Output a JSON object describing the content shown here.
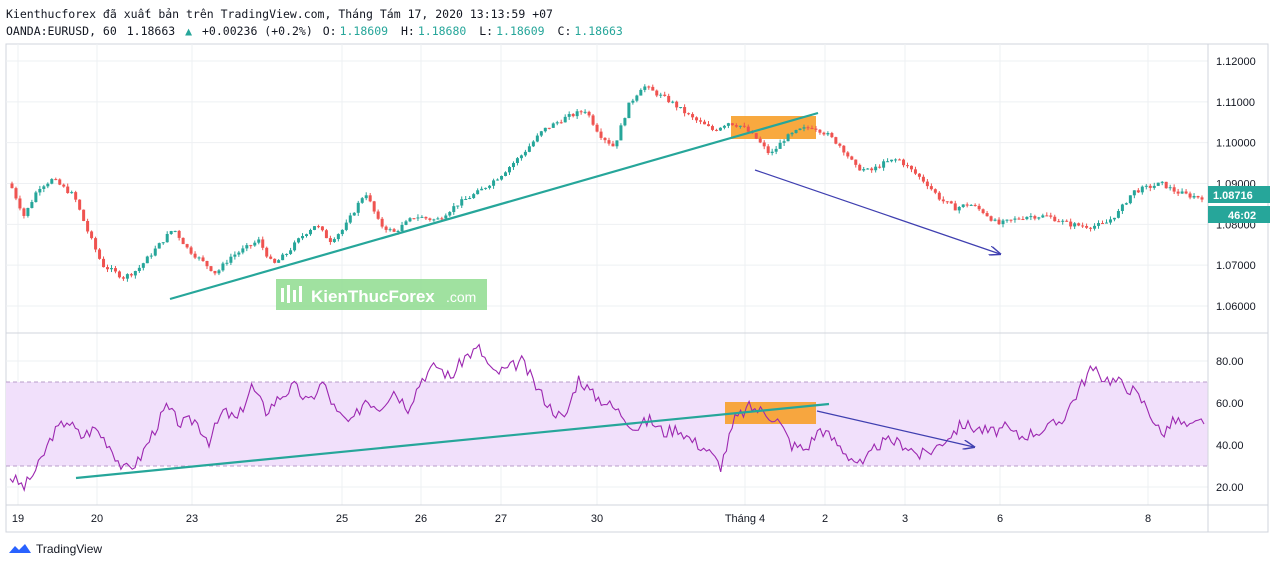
{
  "header": {
    "line1": "Kienthucforex đã xuất bản trên TradingView.com, Tháng Tám 17, 2020 13:13:59 +07",
    "symbol": "OANDA:EURUSD, 60",
    "last": "1.18663",
    "change": "+0.00236 (+0.2%)",
    "o_label": "O:",
    "o_value": "1.18609",
    "h_label": "H:",
    "h_value": "1.18680",
    "l_label": "L:",
    "l_value": "1.18609",
    "c_label": "C:",
    "c_value": "1.18663"
  },
  "price_axis": {
    "ticks": [
      "1.12000",
      "1.11000",
      "1.10000",
      "1.09000",
      "1.08000",
      "1.07000",
      "1.06000"
    ],
    "current_price": "1.08716",
    "countdown": "46:02"
  },
  "rsi_axis": {
    "ticks": [
      "80.00",
      "60.00",
      "40.00",
      "20.00"
    ]
  },
  "time_axis": {
    "ticks": [
      "19",
      "20",
      "23",
      "25",
      "26",
      "27",
      "30",
      "Tháng 4",
      "2",
      "3",
      "6",
      "8"
    ]
  },
  "watermark": {
    "text": "KienThucForex",
    "suffix": ".com"
  },
  "footer": {
    "brand": "TradingView"
  },
  "colors": {
    "up": "#26a69a",
    "down": "#ef5350",
    "trendline": "#26a69a",
    "arrow": "#3f3fb0",
    "highlight": "#f7a02a",
    "rsi_line": "#9c27b0",
    "rsi_band": "#f1e0fb",
    "tag_bg": "#26a69a",
    "grid": "#eef0f3",
    "watermark_bg": "#8fdc8f"
  },
  "chart_data": {
    "type": "candlestick",
    "symbol": "OANDA:EURUSD",
    "timeframe": "60",
    "price_range": [
      1.0555,
      1.1225
    ],
    "rsi_range": [
      15,
      88
    ],
    "rsi_band": [
      30,
      70
    ],
    "date_labels": [
      "19",
      "20",
      "23",
      "25",
      "26",
      "27",
      "30",
      "Tháng 4",
      "2",
      "3",
      "6",
      "8"
    ],
    "price_path": [
      [
        0,
        1.09
      ],
      [
        2,
        1.082
      ],
      [
        4,
        1.089
      ],
      [
        6,
        1.091
      ],
      [
        9,
        1.087
      ],
      [
        11,
        1.078
      ],
      [
        13,
        1.07
      ],
      [
        16,
        1.067
      ],
      [
        18,
        1.069
      ],
      [
        21,
        1.075
      ],
      [
        23,
        1.079
      ],
      [
        25,
        1.074
      ],
      [
        27,
        1.071
      ],
      [
        29,
        1.068
      ],
      [
        31,
        1.072
      ],
      [
        33,
        1.074
      ],
      [
        35,
        1.076
      ],
      [
        37,
        1.07
      ],
      [
        39,
        1.073
      ],
      [
        41,
        1.077
      ],
      [
        43,
        1.08
      ],
      [
        45,
        1.076
      ],
      [
        47,
        1.079
      ],
      [
        50,
        1.088
      ],
      [
        52,
        1.08
      ],
      [
        54,
        1.078
      ],
      [
        57,
        1.082
      ],
      [
        60,
        1.081
      ],
      [
        63,
        1.085
      ],
      [
        66,
        1.088
      ],
      [
        69,
        1.092
      ],
      [
        72,
        1.097
      ],
      [
        75,
        1.103
      ],
      [
        78,
        1.106
      ],
      [
        81,
        1.108
      ],
      [
        83,
        1.102
      ],
      [
        85,
        1.099
      ],
      [
        87,
        1.109
      ],
      [
        89,
        1.114
      ],
      [
        91,
        1.112
      ],
      [
        93,
        1.11
      ],
      [
        96,
        1.106
      ],
      [
        99,
        1.103
      ],
      [
        101,
        1.105
      ],
      [
        103,
        1.104
      ],
      [
        105,
        1.101
      ],
      [
        107,
        1.097
      ],
      [
        109,
        1.101
      ],
      [
        111,
        1.103
      ],
      [
        113,
        1.104
      ],
      [
        115,
        1.102
      ],
      [
        117,
        1.099
      ],
      [
        119,
        1.094
      ],
      [
        121,
        1.093
      ],
      [
        123,
        1.095
      ],
      [
        125,
        1.096
      ],
      [
        127,
        1.093
      ],
      [
        129,
        1.09
      ],
      [
        131,
        1.086
      ],
      [
        133,
        1.084
      ],
      [
        135,
        1.085
      ],
      [
        137,
        1.083
      ],
      [
        139,
        1.08
      ],
      [
        141,
        1.081
      ],
      [
        143,
        1.082
      ],
      [
        146,
        1.082
      ],
      [
        149,
        1.08
      ],
      [
        152,
        1.0795
      ],
      [
        154,
        1.08
      ],
      [
        156,
        1.083
      ],
      [
        158,
        1.088
      ],
      [
        160,
        1.089
      ],
      [
        162,
        1.09
      ],
      [
        164,
        1.088
      ],
      [
        166,
        1.087
      ],
      [
        168,
        1.0866
      ]
    ],
    "rsi_path": [
      [
        0,
        25
      ],
      [
        2,
        20
      ],
      [
        4,
        30
      ],
      [
        6,
        45
      ],
      [
        8,
        52
      ],
      [
        10,
        44
      ],
      [
        12,
        48
      ],
      [
        14,
        40
      ],
      [
        16,
        28
      ],
      [
        18,
        32
      ],
      [
        20,
        45
      ],
      [
        22,
        58
      ],
      [
        24,
        50
      ],
      [
        26,
        52
      ],
      [
        28,
        42
      ],
      [
        30,
        56
      ],
      [
        32,
        52
      ],
      [
        34,
        68
      ],
      [
        36,
        56
      ],
      [
        38,
        63
      ],
      [
        40,
        68
      ],
      [
        42,
        60
      ],
      [
        44,
        70
      ],
      [
        46,
        55
      ],
      [
        48,
        50
      ],
      [
        50,
        62
      ],
      [
        52,
        58
      ],
      [
        54,
        66
      ],
      [
        56,
        58
      ],
      [
        58,
        72
      ],
      [
        60,
        78
      ],
      [
        62,
        72
      ],
      [
        64,
        82
      ],
      [
        66,
        86
      ],
      [
        68,
        74
      ],
      [
        70,
        76
      ],
      [
        72,
        80
      ],
      [
        74,
        68
      ],
      [
        76,
        58
      ],
      [
        78,
        52
      ],
      [
        80,
        72
      ],
      [
        82,
        64
      ],
      [
        84,
        60
      ],
      [
        86,
        55
      ],
      [
        88,
        48
      ],
      [
        90,
        52
      ],
      [
        92,
        46
      ],
      [
        94,
        48
      ],
      [
        96,
        42
      ],
      [
        98,
        38
      ],
      [
        100,
        30
      ],
      [
        102,
        52
      ],
      [
        104,
        58
      ],
      [
        106,
        56
      ],
      [
        108,
        52
      ],
      [
        110,
        40
      ],
      [
        112,
        38
      ],
      [
        114,
        48
      ],
      [
        116,
        42
      ],
      [
        118,
        35
      ],
      [
        120,
        30
      ],
      [
        122,
        40
      ],
      [
        124,
        42
      ],
      [
        126,
        40
      ],
      [
        128,
        35
      ],
      [
        130,
        38
      ],
      [
        132,
        44
      ],
      [
        134,
        50
      ],
      [
        136,
        48
      ],
      [
        138,
        46
      ],
      [
        140,
        48
      ],
      [
        142,
        44
      ],
      [
        144,
        46
      ],
      [
        146,
        48
      ],
      [
        148,
        52
      ],
      [
        150,
        64
      ],
      [
        152,
        76
      ],
      [
        154,
        72
      ],
      [
        156,
        70
      ],
      [
        158,
        66
      ],
      [
        160,
        58
      ],
      [
        162,
        45
      ],
      [
        164,
        52
      ],
      [
        166,
        48
      ],
      [
        168,
        52
      ]
    ]
  }
}
